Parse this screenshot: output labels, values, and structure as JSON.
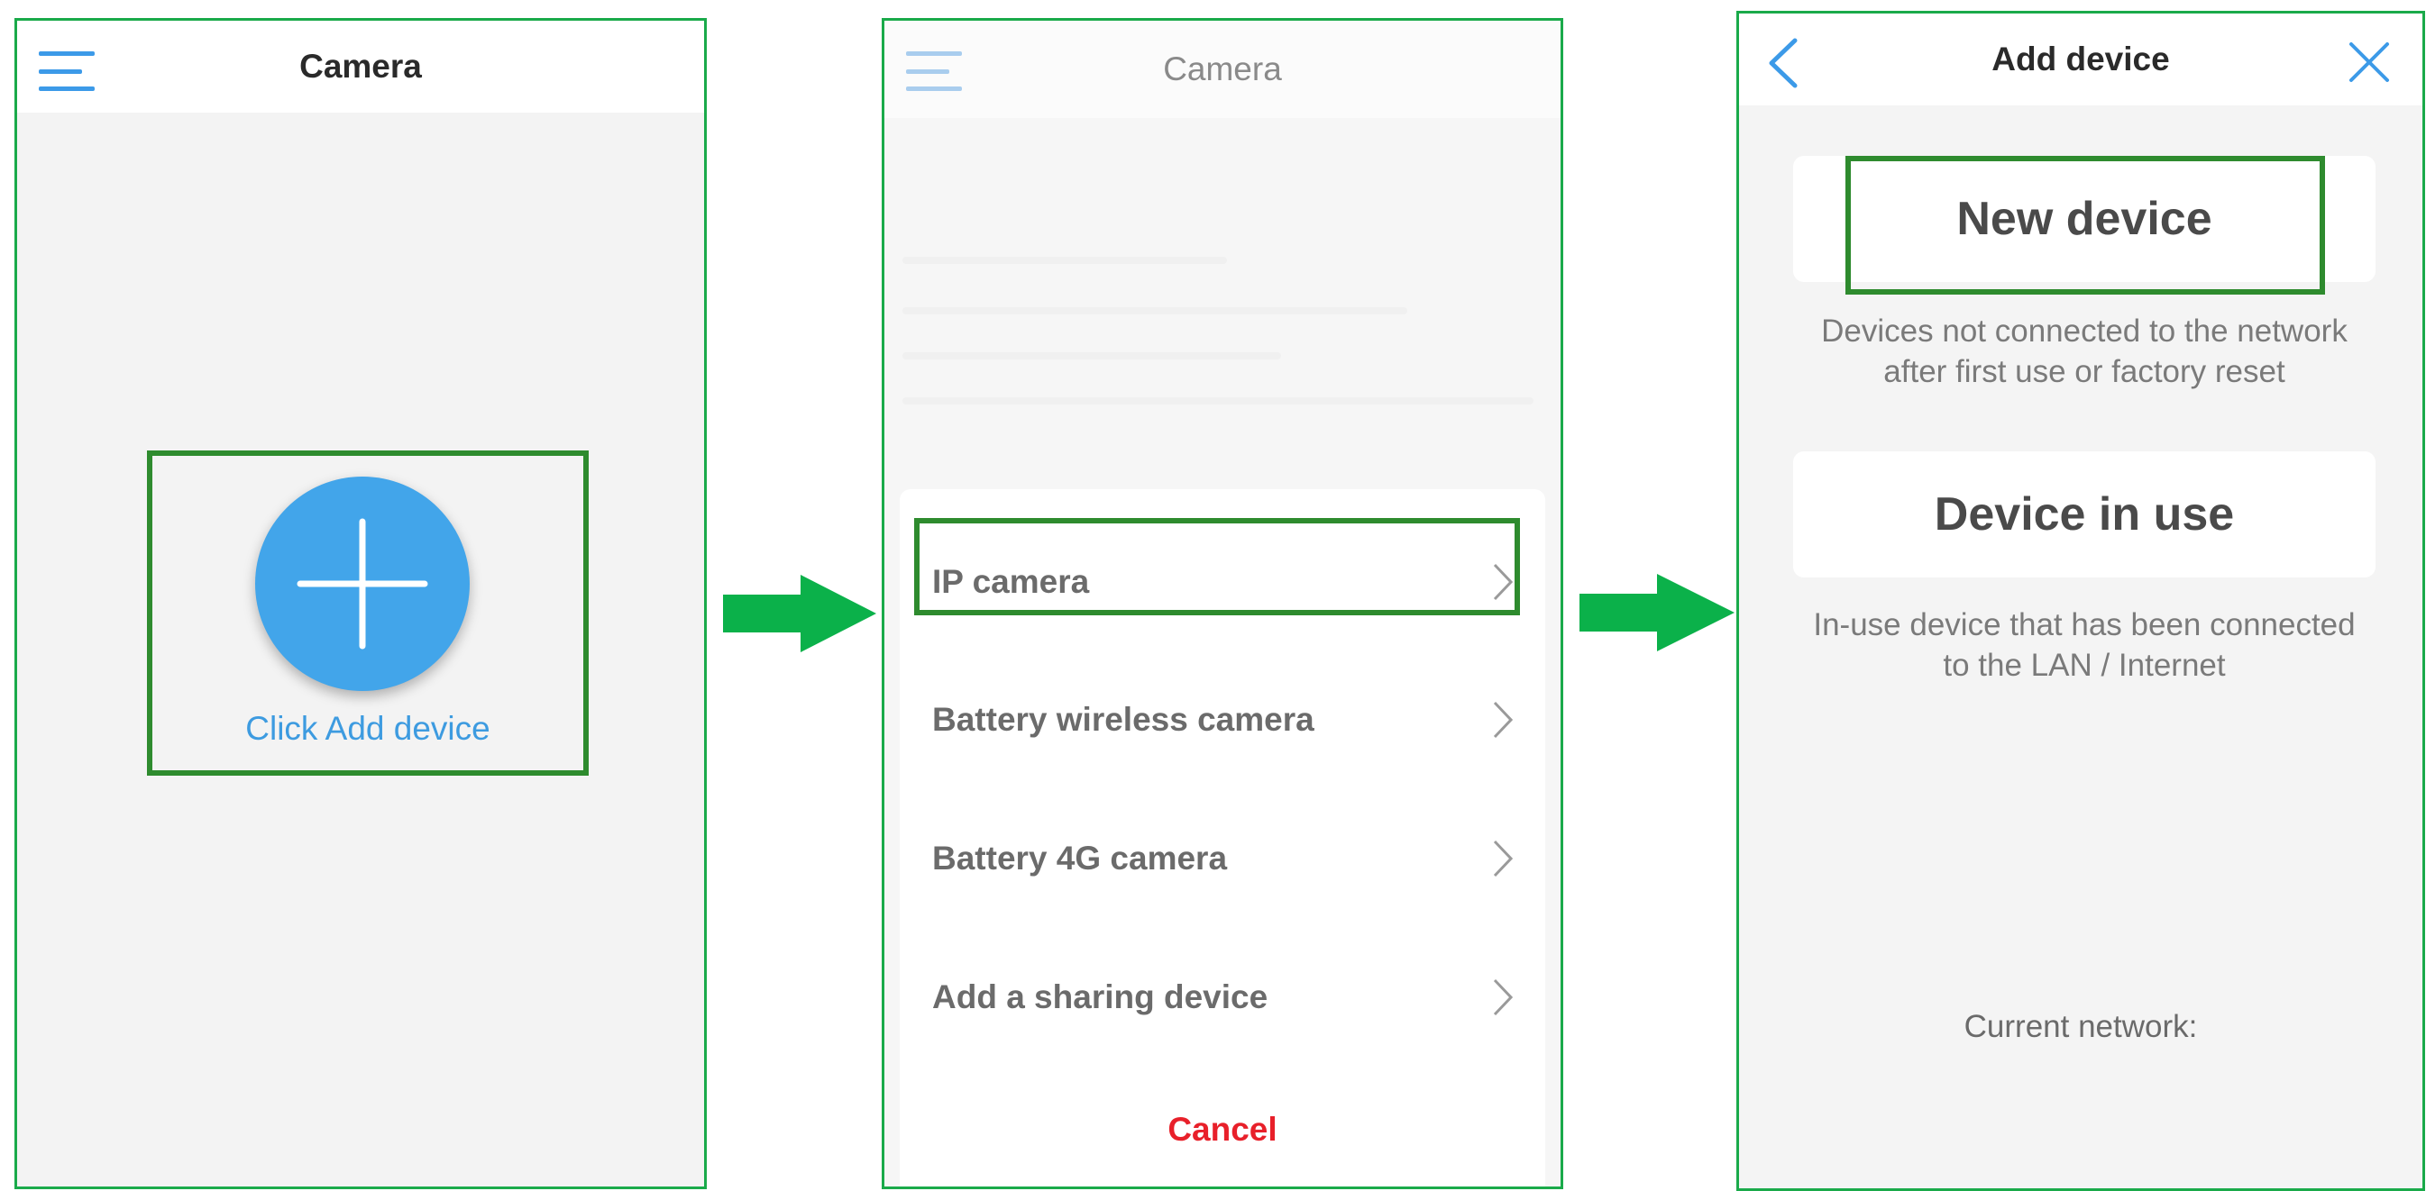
{
  "screen1": {
    "title": "Camera",
    "add_label": "Click Add device"
  },
  "screen2": {
    "title": "Camera",
    "menu_items": [
      {
        "label": "IP camera"
      },
      {
        "label": "Battery wireless camera"
      },
      {
        "label": "Battery 4G camera"
      },
      {
        "label": "Add a sharing device"
      }
    ],
    "cancel_label": "Cancel"
  },
  "screen3": {
    "title": "Add device",
    "new_device": {
      "label": "New device",
      "description_line1": "Devices not connected to the network",
      "description_line2": "after first use or factory reset"
    },
    "device_in_use": {
      "label": "Device in use",
      "description_line1": "In-use device that has been connected",
      "description_line2": "to the LAN / Internet"
    },
    "current_network_label": "Current network:"
  },
  "colors": {
    "accent_blue": "#42a5ea",
    "highlight_green": "#2e8b2e",
    "arrow_green": "#0bb14a",
    "cancel_red": "#e8202a"
  },
  "icons": [
    "menu-icon",
    "plus-icon",
    "chevron-right-icon",
    "back-icon",
    "close-icon",
    "arrow-right-icon"
  ]
}
